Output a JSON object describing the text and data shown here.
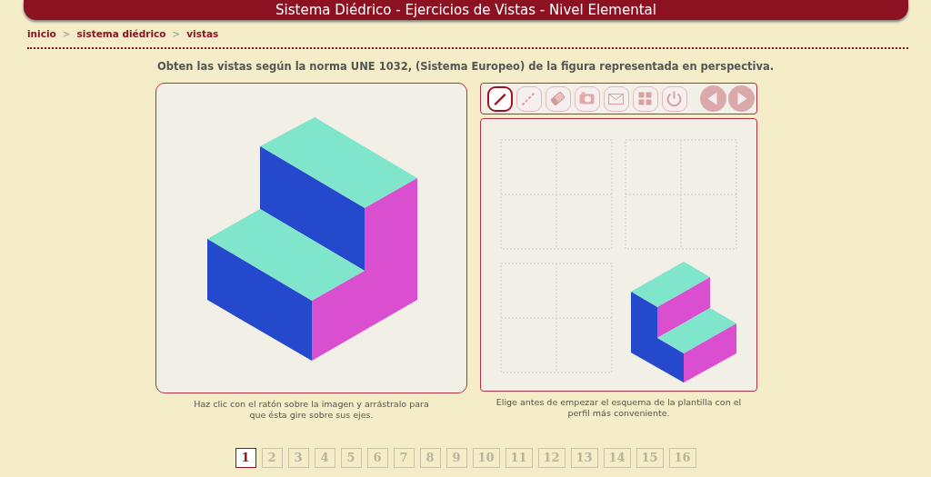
{
  "header": {
    "title": "Sistema Diédrico - Ejercicios de Vistas - Nivel Elemental"
  },
  "breadcrumb": [
    {
      "label": "inicio",
      "separator": ">"
    },
    {
      "label": "sistema diédrico",
      "separator": ">"
    },
    {
      "label": "vistas"
    }
  ],
  "instruction": "Obten las vistas según la norma UNE 1032, (Sistema Europeo) de la figura representada en perspectiva.",
  "perspective": {
    "caption": "Haz clic con el ratón sobre la imagen y arrástralo para que ésta gire sobre sus ejes."
  },
  "toolbar": {
    "tools": [
      {
        "kind": "line",
        "selected": true
      },
      {
        "kind": "dashed",
        "selected": false
      },
      {
        "kind": "eraser",
        "selected": false
      },
      {
        "kind": "camera",
        "selected": false
      },
      {
        "kind": "mail",
        "selected": false
      },
      {
        "kind": "layout",
        "selected": false
      },
      {
        "kind": "power",
        "selected": false
      }
    ],
    "nav": [
      {
        "kind": "prev"
      },
      {
        "kind": "next"
      }
    ]
  },
  "template": {
    "caption": "Elige antes de empezar el esquema de la plantilla con el perfil más conveniente."
  },
  "pages": [
    {
      "label": "1",
      "selected": true
    },
    {
      "label": "2",
      "selected": false
    },
    {
      "label": "3",
      "selected": false
    },
    {
      "label": "4",
      "selected": false
    },
    {
      "label": "5",
      "selected": false
    },
    {
      "label": "6",
      "selected": false
    },
    {
      "label": "7",
      "selected": false
    },
    {
      "label": "8",
      "selected": false
    },
    {
      "label": "9",
      "selected": false
    },
    {
      "label": "10",
      "selected": false
    },
    {
      "label": "11",
      "selected": false
    },
    {
      "label": "12",
      "selected": false
    },
    {
      "label": "13",
      "selected": false
    },
    {
      "label": "14",
      "selected": false
    },
    {
      "label": "15",
      "selected": false
    },
    {
      "label": "16",
      "selected": false
    }
  ]
}
